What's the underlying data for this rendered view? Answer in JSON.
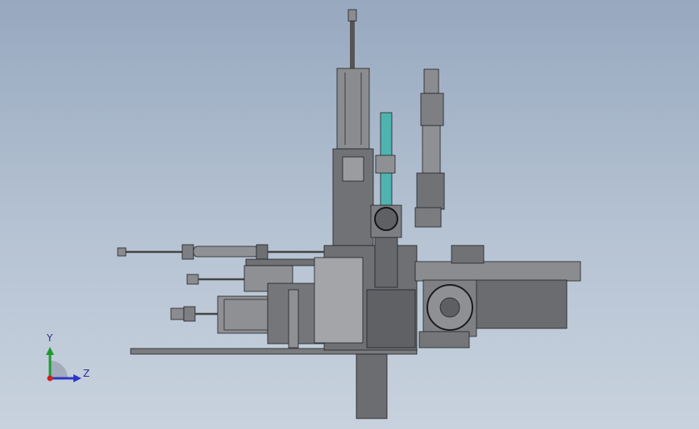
{
  "triad": {
    "y_label": "Y",
    "z_label": "Z",
    "y_color": "#1e9a2f",
    "z_color": "#2b36c9",
    "x_color": "#d21f1f"
  },
  "colors": {
    "steel": "#6d6f73",
    "steel_dark": "#3c3d40",
    "steel_light": "#9a9c9f",
    "accent_cyan": "#4fb3b0",
    "background_top": "#97a8bf",
    "background_bottom": "#c8d2de"
  }
}
